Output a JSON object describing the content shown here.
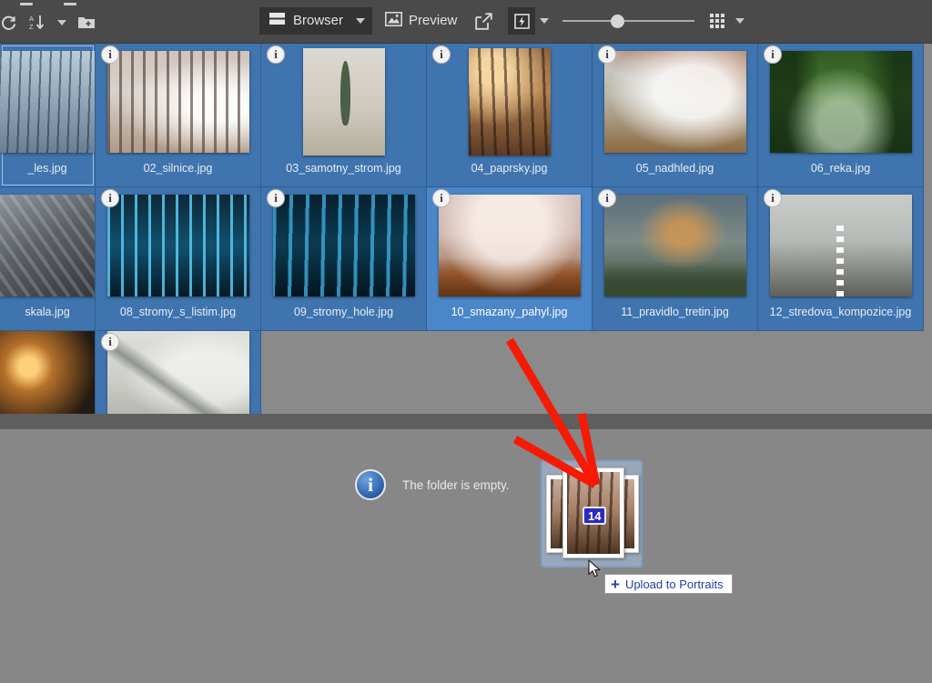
{
  "toolbar": {
    "refresh_icon": "refresh-icon",
    "sort_icon": "sort-az-icon",
    "sort_caret": "chevron-down-icon",
    "new_folder_icon": "new-folder-icon",
    "browser_label": "Browser",
    "browser_icon": "browser-layout-icon",
    "browser_caret": "chevron-down-icon",
    "preview_label": "Preview",
    "preview_icon": "image-icon",
    "open_external_icon": "open-external-icon",
    "bolt_icon": "lightning-bolt-icon",
    "bolt_caret": "chevron-down-icon",
    "zoom_slider_value": 41,
    "grid_icon": "grid-view-icon",
    "grid_caret": "chevron-down-icon"
  },
  "browser": {
    "info_badge_glyph": "i",
    "rows": [
      [
        {
          "name": "_les.jpg",
          "art": "w1",
          "shape": "wide",
          "selected": false,
          "selbox": true,
          "first": true
        },
        {
          "name": "02_silnice.jpg",
          "art": "w2",
          "shape": "wide",
          "selected": false
        },
        {
          "name": "03_samotny_strom.jpg",
          "art": "w3",
          "shape": "tall",
          "selected": false
        },
        {
          "name": "04_paprsky.jpg",
          "art": "w4",
          "shape": "tall",
          "selected": false
        },
        {
          "name": "05_nadhled.jpg",
          "art": "w5",
          "shape": "wide",
          "selected": false
        },
        {
          "name": "06_reka.jpg",
          "art": "w6",
          "shape": "wide",
          "selected": false
        }
      ],
      [
        {
          "name": "skala.jpg",
          "art": "w7",
          "shape": "wide",
          "selected": false,
          "first": true
        },
        {
          "name": "08_stromy_s_listim.jpg",
          "art": "w8",
          "shape": "wide",
          "selected": false
        },
        {
          "name": "09_stromy_hole.jpg",
          "art": "w9",
          "shape": "wide",
          "selected": false
        },
        {
          "name": "10_smazany_pahyl.jpg",
          "art": "w10",
          "shape": "wide",
          "selected": true
        },
        {
          "name": "11_pravidlo_tretin.jpg",
          "art": "w11",
          "shape": "wide",
          "selected": false
        },
        {
          "name": "12_stredova_kompozice.jpg",
          "art": "w12",
          "shape": "wide",
          "selected": false
        }
      ],
      [
        {
          "name": "",
          "art": "w13",
          "shape": "wide",
          "selected": false,
          "first": true
        },
        {
          "name": "",
          "art": "w14",
          "shape": "wide",
          "selected": false
        }
      ]
    ]
  },
  "empty_panel": {
    "message": "The folder is empty.",
    "info_icon_glyph": "i"
  },
  "drag": {
    "count_badge": "14",
    "drop_tooltip_plus": "+",
    "drop_tooltip_label": "Upload to Portraits",
    "cursor_icon": "mouse-pointer-icon"
  },
  "annotation": {
    "arrow_color": "#f61a05"
  },
  "colors": {
    "toolbar_bg": "#4a4a4a",
    "grid_cell_bg": "#3f74ae",
    "grid_cell_selected_bg": "#4a86c8",
    "panel_bg": "#878787",
    "splitter_bg": "#5e5e5e",
    "tooltip_text": "#1d3f9e",
    "badge_bg": "#2b2bbf"
  }
}
